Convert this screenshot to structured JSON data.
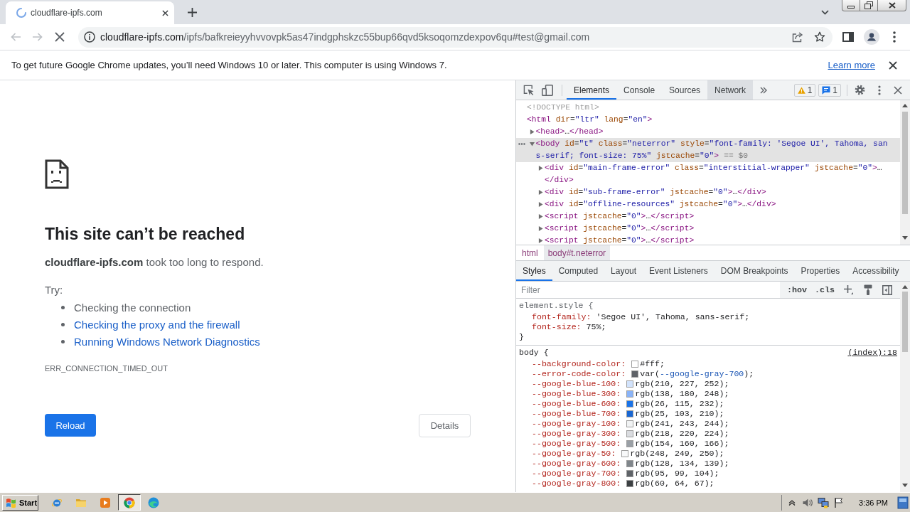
{
  "tabs": [
    {
      "title": "cloudflare-ipfs.com",
      "selected": true,
      "loading": true
    }
  ],
  "toolbar": {
    "back": {
      "disabled": true
    },
    "forward": {
      "disabled": true
    },
    "url_host": "cloudflare-ipfs.com",
    "url_path": "/ipfs/bafkreieyyhvvovpk5as47indgphskzc55bup66qvd5ksoqomzdexpov6qu#test@gmail.com"
  },
  "infobar": {
    "message": "To get future Google Chrome updates, you’ll need Windows 10 or later. This computer is using Windows 7.",
    "link": "Learn more"
  },
  "error_page": {
    "title": "This site can’t be reached",
    "message": "**cloudflare-ipfs.com** took too long to respond.",
    "try_label": "Try:",
    "suggestions": [
      {
        "text": "Checking the connection",
        "kind": "plain"
      },
      {
        "text": "Checking the proxy and the firewall",
        "kind": "link"
      },
      {
        "text": "Running Windows Network Diagnostics",
        "kind": "link"
      }
    ],
    "error_code": "ERR_CONNECTION_TIMED_OUT",
    "buttons": {
      "reload": "Reload",
      "details": "Details"
    }
  },
  "devtools": {
    "tabs": [
      {
        "label": "Elements",
        "selected": true,
        "hovered": false
      },
      {
        "label": "Console",
        "selected": false,
        "hovered": false
      },
      {
        "label": "Sources",
        "selected": false,
        "hovered": false
      },
      {
        "label": "Network",
        "selected": false,
        "hovered": true
      }
    ],
    "warnings": "1",
    "messages": "1",
    "dom_tree": [
      {
        "kind": "doctype",
        "lines": [
          "<!DOCTYPE html>"
        ],
        "selected": false
      },
      {
        "kind": "element",
        "lines": [
          "<html dir=\"ltr\" lang=\"en\">"
        ],
        "selected": false,
        "children": [
          {
            "kind": "element",
            "lines": [
              "<head>…</head>"
            ],
            "expanded": false,
            "selected": false
          },
          {
            "kind": "element",
            "lines": [
              "<body id=\"t\" class=\"neterror\" style=\"font-family: 'Segoe UI', Tahoma, san",
              "s-serif; font-size: 75%\" jstcache=\"0\">"
            ],
            "marker": "== $0",
            "expanded": true,
            "selected": true,
            "children": [
              {
                "kind": "element",
                "lines": [
                  "<div id=\"main-frame-error\" class=\"interstitial-wrapper\" jstcache=\"0\">…",
                  "</div>"
                ],
                "expanded": false,
                "selected": false
              },
              {
                "kind": "element",
                "lines": [
                  "<div id=\"sub-frame-error\" jstcache=\"0\">…</div>"
                ],
                "expanded": false,
                "selected": false
              },
              {
                "kind": "element",
                "lines": [
                  "<div id=\"offline-resources\" jstcache=\"0\">…</div>"
                ],
                "expanded": false,
                "selected": false
              },
              {
                "kind": "element",
                "lines": [
                  "<script jstcache=\"0\">…</script>"
                ],
                "expanded": false,
                "selected": false
              },
              {
                "kind": "element",
                "lines": [
                  "<script jstcache=\"0\">…</script>"
                ],
                "expanded": false,
                "selected": false
              },
              {
                "kind": "element",
                "lines": [
                  "<script jstcache=\"0\">…</script>"
                ],
                "expanded": false,
                "selected": false
              }
            ]
          }
        ]
      }
    ],
    "breadcrumbs": [
      {
        "label": "html",
        "selected": false
      },
      {
        "label": "body#t.neterror",
        "selected": true
      }
    ],
    "panel_tabs": [
      {
        "label": "Styles",
        "selected": true
      },
      {
        "label": "Computed",
        "selected": false
      },
      {
        "label": "Layout",
        "selected": false
      },
      {
        "label": "Event Listeners",
        "selected": false
      },
      {
        "label": "DOM Breakpoints",
        "selected": false
      },
      {
        "label": "Properties",
        "selected": false
      },
      {
        "label": "Accessibility",
        "selected": false
      }
    ],
    "filter": {
      "placeholder": "Filter"
    },
    "style_toggles": [
      ":hov",
      ".cls"
    ],
    "rules": [
      {
        "kind": "inline",
        "selector": "element.style {",
        "properties": [
          {
            "name": "font-family:",
            "value": "'Segoe UI', Tahoma, sans-serif;"
          },
          {
            "name": "font-size:",
            "value": "75%;"
          }
        ],
        "close": "}"
      },
      {
        "kind": "matched",
        "selector": "body {",
        "source": "(index):18",
        "properties": [
          {
            "name": "--background-color:",
            "value": "#fff;",
            "color": "#ffffff"
          },
          {
            "name": "--error-code-color:",
            "value": "var(--google-gray-700);",
            "color": "#5f6368"
          },
          {
            "name": "--google-blue-100:",
            "value": "rgb(210, 227, 252);",
            "color": "#d2e3fc"
          },
          {
            "name": "--google-blue-300:",
            "value": "rgb(138, 180, 248);",
            "color": "#8ab4f8"
          },
          {
            "name": "--google-blue-600:",
            "value": "rgb(26, 115, 232);",
            "color": "#1a73e8"
          },
          {
            "name": "--google-blue-700:",
            "value": "rgb(25, 103, 210);",
            "color": "#1967d2"
          },
          {
            "name": "--google-gray-100:",
            "value": "rgb(241, 243, 244);",
            "color": "#f1f3f4"
          },
          {
            "name": "--google-gray-300:",
            "value": "rgb(218, 220, 224);",
            "color": "#dadce0"
          },
          {
            "name": "--google-gray-500:",
            "value": "rgb(154, 160, 166);",
            "color": "#9aa0a6"
          },
          {
            "name": "--google-gray-50:",
            "value": "rgb(248, 249, 250);",
            "color": "#f8f9fa"
          },
          {
            "name": "--google-gray-600:",
            "value": "rgb(128, 134, 139);",
            "color": "#80868b"
          },
          {
            "name": "--google-gray-700:",
            "value": "rgb(95, 99, 104);",
            "color": "#5f6368"
          },
          {
            "name": "--google-gray-800:",
            "value": "rgb(60, 64, 67);",
            "color": "#3c4043"
          }
        ]
      }
    ]
  },
  "taskbar": {
    "start": "Start",
    "apps": [
      {
        "selected": false
      },
      {
        "selected": false
      },
      {
        "selected": false
      },
      {
        "selected": true
      },
      {
        "selected": false
      }
    ],
    "clock": "3:36 PM"
  }
}
